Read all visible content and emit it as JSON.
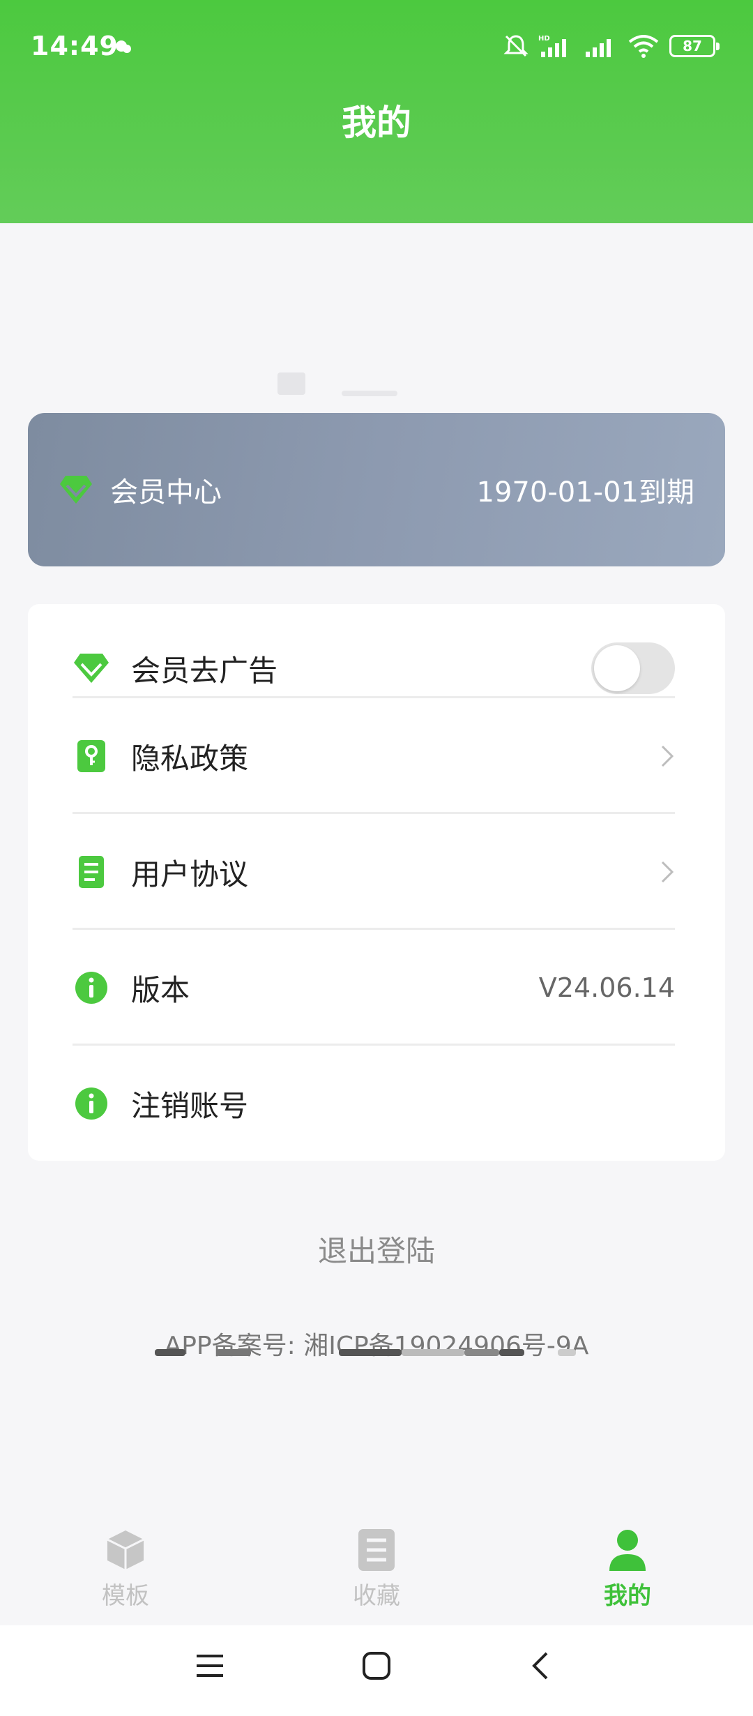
{
  "status_bar": {
    "time": "14:49",
    "battery": "87"
  },
  "header": {
    "title": "我的"
  },
  "member_card": {
    "label": "会员中心",
    "expiry": "1970-01-01到期"
  },
  "settings": {
    "items": [
      {
        "label": "会员去广告",
        "icon": "diamond-icon",
        "control": "toggle",
        "toggle_on": false
      },
      {
        "label": "隐私政策",
        "icon": "key-icon",
        "control": "chevron"
      },
      {
        "label": "用户协议",
        "icon": "document-icon",
        "control": "chevron"
      },
      {
        "label": "版本",
        "icon": "info-icon",
        "value": "V24.06.14"
      },
      {
        "label": "注销账号",
        "icon": "info-icon"
      }
    ]
  },
  "logout": {
    "label": "退出登陆"
  },
  "footer": {
    "icp": "APP备案号: 湘ICP备19024906号-9A"
  },
  "bottom_nav": {
    "items": [
      {
        "label": "模板",
        "icon": "cube-icon",
        "active": false
      },
      {
        "label": "收藏",
        "icon": "list-icon",
        "active": false
      },
      {
        "label": "我的",
        "icon": "person-icon",
        "active": true
      }
    ]
  },
  "colors": {
    "accent": "#4cc93f",
    "header": "#63cc59",
    "member_card": "#8d9ab0",
    "inactive": "#c2c2c2"
  }
}
